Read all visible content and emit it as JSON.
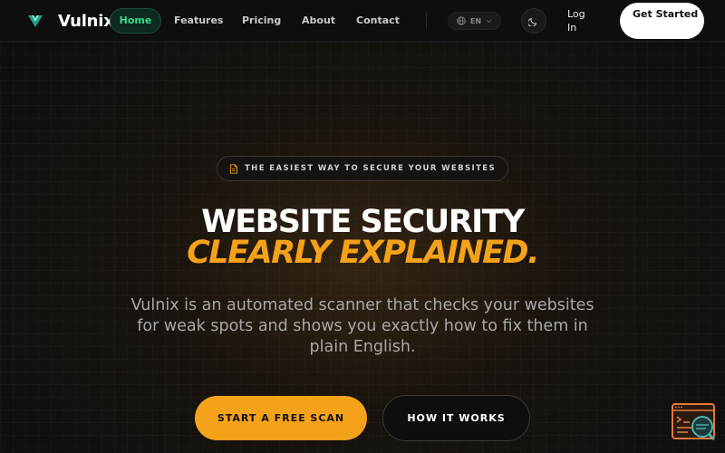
{
  "nav": {
    "brand": "Vulnix",
    "links": [
      "Home",
      "Features",
      "Pricing",
      "About",
      "Contact"
    ],
    "active_link": "Home",
    "language": "EN",
    "login_label": "Log In",
    "cta_label": "Get Started"
  },
  "hero": {
    "tagline": "THE EASIEST WAY TO SECURE YOUR WEBSITES",
    "title_line1": "WEBSITE SECURITY",
    "title_line2": "CLEARLY EXPLAINED.",
    "subtitle": "Vulnix is an automated scanner that checks your websites for weak spots and shows you exactly how to fix them in plain English.",
    "primary_button": "START A FREE SCAN",
    "secondary_button": "HOW IT WORKS"
  },
  "icons": {
    "logo": "vulnix-logo-icon",
    "language": "globe-icon",
    "language_caret": "chevron-down-icon",
    "theme": "moon-icon",
    "tagline": "document-icon",
    "widget": "chat-widget-icon"
  },
  "colors": {
    "accent": "#f5a21b",
    "active_nav": "#39d98a",
    "background": "#0f0e0d"
  }
}
